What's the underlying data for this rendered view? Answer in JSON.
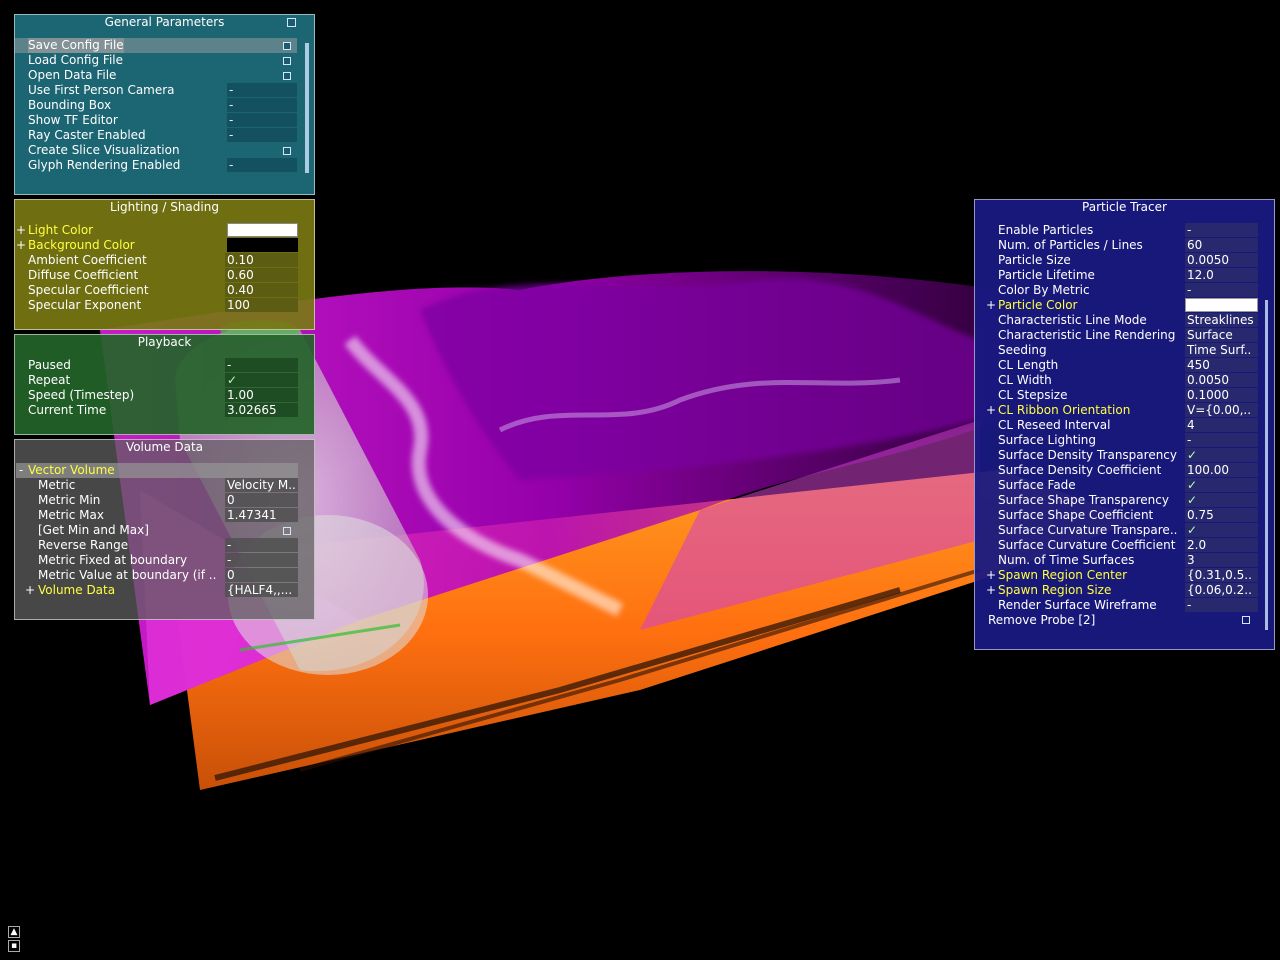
{
  "colors": {
    "general_bg": "#1e6e7d",
    "lighting_bg": "#787814",
    "playback_bg": "#236428",
    "volume_bg": "#5f5f5f",
    "tracer_bg": "#191982",
    "highlight_label": "#ffff40",
    "sheet_magenta": "#d000d8",
    "sheet_orange": "#ff7a10"
  },
  "general": {
    "title": "General Parameters",
    "items": [
      {
        "label": "Save Config File",
        "value": "",
        "kind": "button"
      },
      {
        "label": "Load Config File",
        "value": "",
        "kind": "button"
      },
      {
        "label": "Open Data File",
        "value": "",
        "kind": "button"
      },
      {
        "label": "Use First Person Camera",
        "value": "-",
        "kind": "bool"
      },
      {
        "label": "Bounding Box",
        "value": "-",
        "kind": "bool"
      },
      {
        "label": "Show TF Editor",
        "value": "-",
        "kind": "bool"
      },
      {
        "label": "Ray Caster Enabled",
        "value": "-",
        "kind": "bool"
      },
      {
        "label": "Create Slice Visualization",
        "value": "",
        "kind": "button"
      },
      {
        "label": "Glyph Rendering Enabled",
        "value": "-",
        "kind": "bool"
      }
    ],
    "minimize_icon": "minimize-icon"
  },
  "lighting": {
    "title": "Lighting / Shading",
    "light_color_label": "Light Color",
    "background_color_label": "Background Color",
    "light_color": "#ffffff",
    "background_color": "#000000",
    "items": [
      {
        "label": "Ambient Coefficient",
        "value": "0.10"
      },
      {
        "label": "Diffuse Coefficient",
        "value": "0.60"
      },
      {
        "label": "Specular Coefficient",
        "value": "0.40"
      },
      {
        "label": "Specular Exponent",
        "value": "100"
      }
    ]
  },
  "playback": {
    "title": "Playback",
    "items": [
      {
        "label": "Paused",
        "value": "-"
      },
      {
        "label": "Repeat",
        "value": "✓"
      },
      {
        "label": "Speed (Timestep)",
        "value": "1.00"
      },
      {
        "label": "Current Time",
        "value": "3.02665"
      }
    ]
  },
  "volume": {
    "title": "Volume Data",
    "group_label": "Vector Volume",
    "group_toggle": "-",
    "items": [
      {
        "label": "Metric",
        "value": "Velocity M.."
      },
      {
        "label": "Metric Min",
        "value": "0"
      },
      {
        "label": "Metric Max",
        "value": "1.47341"
      },
      {
        "label": "[Get Min and Max]",
        "value": ""
      },
      {
        "label": "Reverse Range",
        "value": "-"
      },
      {
        "label": "Metric Fixed at boundary",
        "value": "-"
      },
      {
        "label": "Metric Value at boundary (if ..",
        "value": "0"
      }
    ],
    "data_label": "Volume Data",
    "data_value": "{HALF4,,..."
  },
  "tracer": {
    "title": "Particle Tracer",
    "items": [
      {
        "label": "Enable Particles",
        "value": "-",
        "plus": false,
        "yellow": false
      },
      {
        "label": "Num. of Particles / Lines",
        "value": "60",
        "plus": false,
        "yellow": false
      },
      {
        "label": "Particle Size",
        "value": "0.0050",
        "plus": false,
        "yellow": false
      },
      {
        "label": "Particle Lifetime",
        "value": "12.0",
        "plus": false,
        "yellow": false
      },
      {
        "label": "Color By Metric",
        "value": "-",
        "plus": false,
        "yellow": false
      },
      {
        "label": "Particle Color",
        "value": "",
        "plus": true,
        "yellow": true,
        "swatch": "#ffffff"
      },
      {
        "label": "Characteristic Line Mode",
        "value": "Streaklines",
        "plus": false,
        "yellow": false
      },
      {
        "label": "Characteristic Line Rendering",
        "value": "Surface",
        "plus": false,
        "yellow": false
      },
      {
        "label": "Seeding",
        "value": "Time Surf..",
        "plus": false,
        "yellow": false
      },
      {
        "label": "CL Length",
        "value": "450",
        "plus": false,
        "yellow": false
      },
      {
        "label": "CL Width",
        "value": "0.0050",
        "plus": false,
        "yellow": false
      },
      {
        "label": "CL Stepsize",
        "value": "0.1000",
        "plus": false,
        "yellow": false
      },
      {
        "label": "CL Ribbon Orientation",
        "value": "V={0.00,..",
        "plus": true,
        "yellow": true
      },
      {
        "label": "CL Reseed Interval",
        "value": "4",
        "plus": false,
        "yellow": false
      },
      {
        "label": "Surface Lighting",
        "value": "-",
        "plus": false,
        "yellow": false
      },
      {
        "label": "Surface Density Transparency",
        "value": "✓",
        "plus": false,
        "yellow": false
      },
      {
        "label": "Surface Density Coefficient",
        "value": "100.00",
        "plus": false,
        "yellow": false
      },
      {
        "label": "Surface Fade",
        "value": "✓",
        "plus": false,
        "yellow": false
      },
      {
        "label": "Surface Shape Transparency",
        "value": "✓",
        "plus": false,
        "yellow": false
      },
      {
        "label": "Surface Shape Coefficient",
        "value": "0.75",
        "plus": false,
        "yellow": false
      },
      {
        "label": "Surface Curvature Transpare..",
        "value": "✓",
        "plus": false,
        "yellow": false
      },
      {
        "label": "Surface Curvature Coefficient",
        "value": "2.0",
        "plus": false,
        "yellow": false
      },
      {
        "label": "Num. of Time Surfaces",
        "value": "3",
        "plus": false,
        "yellow": false
      },
      {
        "label": "Spawn Region Center",
        "value": "{0.31,0.5..",
        "plus": true,
        "yellow": true
      },
      {
        "label": "Spawn Region Size",
        "value": "{0.06,0.2..",
        "plus": true,
        "yellow": true
      },
      {
        "label": "Render Surface Wireframe",
        "value": "-",
        "plus": false,
        "yellow": false
      }
    ],
    "remove_label": "Remove Probe [2]"
  },
  "corner": {
    "up_icon": "arrow-up-icon",
    "settings_icon": "settings-icon"
  }
}
